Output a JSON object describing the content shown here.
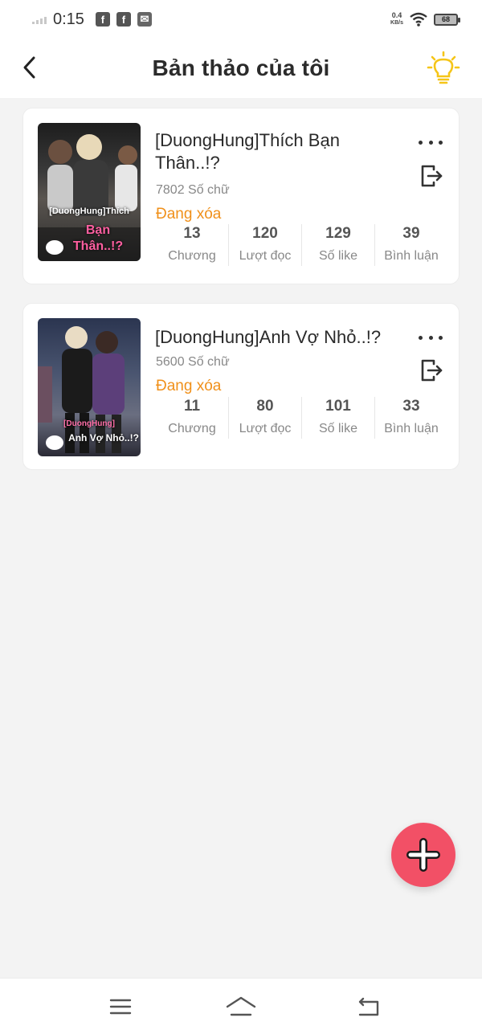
{
  "status_bar": {
    "time": "0:15",
    "net_speed_value": "0.4",
    "net_speed_unit": "KB/s",
    "battery": "68",
    "notification_icons": [
      "facebook-icon",
      "facebook-icon",
      "mail-icon"
    ]
  },
  "header": {
    "title": "Bản thảo của tôi"
  },
  "colors": {
    "accent_orange": "#f0901a",
    "fab_red": "#f25066",
    "bulb_yellow": "#f5c518"
  },
  "stories": [
    {
      "title": "[DuongHung]Thích Bạn Thân..!?",
      "word_count": "7802 Số chữ",
      "status": "Đang xóa",
      "cover_caption_top": "[DuongHung]Thích",
      "cover_caption_pink": "Bạn Thân..!?",
      "stats": [
        {
          "value": "13",
          "label": "Chương"
        },
        {
          "value": "120",
          "label": "Lượt đọc"
        },
        {
          "value": "129",
          "label": "Số like"
        },
        {
          "value": "39",
          "label": "Bình luận"
        }
      ]
    },
    {
      "title": "[DuongHung]Anh Vợ Nhỏ..!?",
      "word_count": "5600 Số chữ",
      "status": "Đang xóa",
      "cover_caption_top": "[DuongHung]",
      "cover_caption_pink": "Anh Vợ Nhỏ..!?",
      "stats": [
        {
          "value": "11",
          "label": "Chương"
        },
        {
          "value": "80",
          "label": "Lượt đọc"
        },
        {
          "value": "101",
          "label": "Số like"
        },
        {
          "value": "33",
          "label": "Bình luận"
        }
      ]
    }
  ],
  "fab": {
    "icon": "plus-icon"
  },
  "bottom_nav": {
    "icons": [
      "menu-icon",
      "home-icon",
      "back-nav-icon"
    ]
  }
}
